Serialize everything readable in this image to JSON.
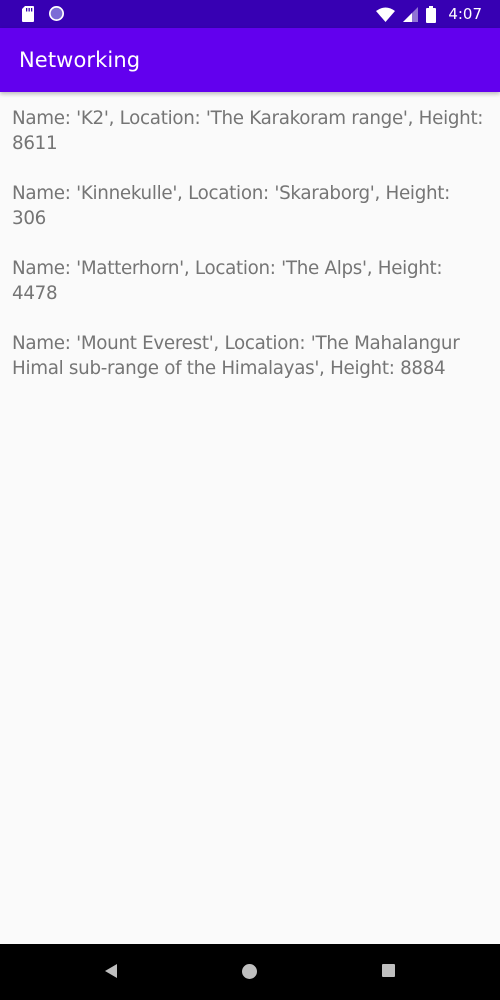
{
  "status_bar": {
    "time": "4:07",
    "icons": [
      "sd-card-icon",
      "notification-circle-icon",
      "wifi-icon",
      "cell-signal-icon",
      "battery-icon"
    ],
    "background": "#3700b3"
  },
  "app_bar": {
    "title": "Networking",
    "background": "#6200ee"
  },
  "mountains": [
    "Name: 'K2', Location: 'The Karakoram range', Height: 8611",
    "Name: 'Kinnekulle', Location: 'Skaraborg', Height: 306",
    "Name: 'Matterhorn', Location: 'The Alps', Height: 4478",
    "Name: 'Mount Everest', Location: 'The Mahalangur Himal sub-range of the Himalayas', Height: 8884"
  ],
  "text_color": "#757575",
  "nav_bar": {
    "icons": [
      "back-icon",
      "home-icon",
      "recents-icon"
    ]
  }
}
